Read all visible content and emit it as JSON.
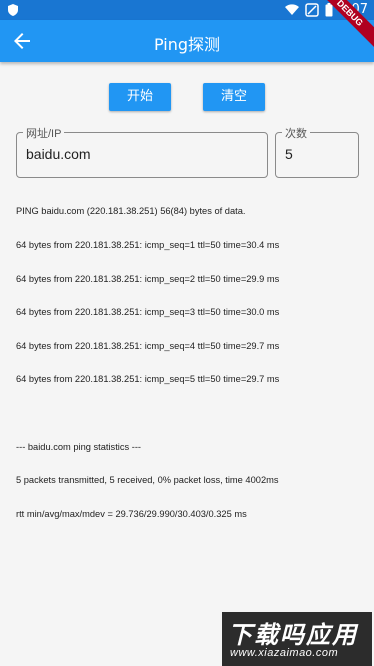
{
  "status_bar": {
    "time": "3:07",
    "icons": [
      "shield-icon",
      "wifi-icon",
      "mute-icon",
      "battery-icon"
    ]
  },
  "app_bar": {
    "title": "Ping探测",
    "back_icon": "arrow-left-icon",
    "banner": "DEBUG"
  },
  "actions": {
    "start_label": "开始",
    "clear_label": "清空"
  },
  "form": {
    "host_label": "网址/IP",
    "host_value": "baidu.com",
    "count_label": "次数",
    "count_value": "5"
  },
  "output": {
    "lines": [
      "PING baidu.com (220.181.38.251) 56(84) bytes of data.",
      "64 bytes from 220.181.38.251: icmp_seq=1 ttl=50 time=30.4 ms",
      "64 bytes from 220.181.38.251: icmp_seq=2 ttl=50 time=29.9 ms",
      "64 bytes from 220.181.38.251: icmp_seq=3 ttl=50 time=30.0 ms",
      "64 bytes from 220.181.38.251: icmp_seq=4 ttl=50 time=29.7 ms",
      "64 bytes from 220.181.38.251: icmp_seq=5 ttl=50 time=29.7 ms",
      "",
      "--- baidu.com ping statistics ---",
      "5 packets transmitted, 5 received, 0% packet loss, time 4002ms",
      "rtt min/avg/max/mdev = 29.736/29.990/30.403/0.325 ms"
    ]
  },
  "watermark": {
    "title": "下载吗应用",
    "domain": "www.xiazaimao.com"
  },
  "colors": {
    "primary": "#2196f3",
    "primary_dark": "#1976d2",
    "background": "#f5f5f5",
    "debug": "#b00020"
  }
}
